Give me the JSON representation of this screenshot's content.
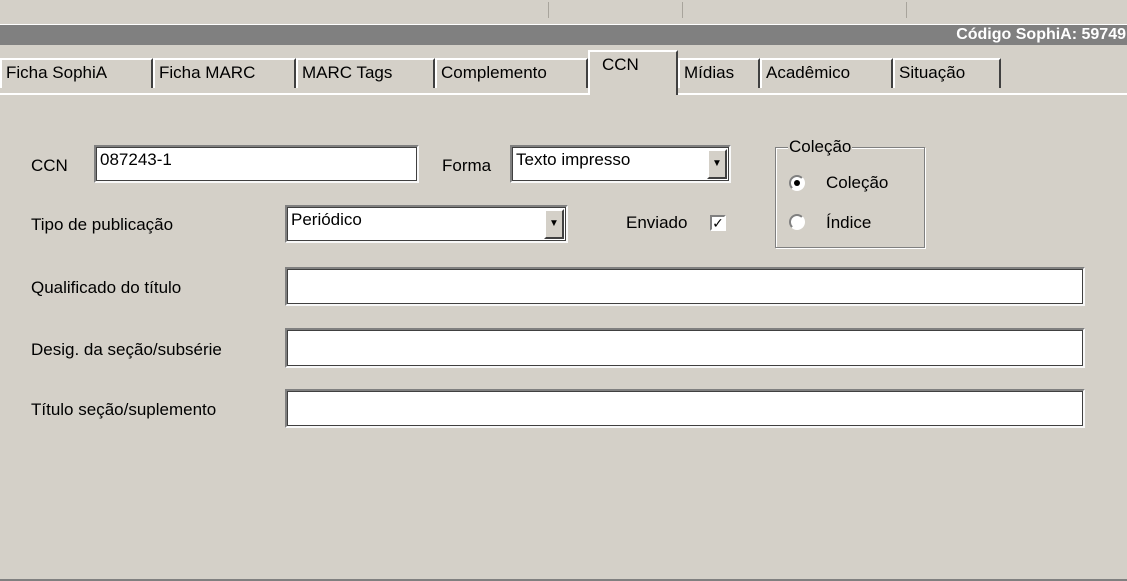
{
  "header": {
    "codigo_label": "Código SophiA: 59749"
  },
  "tabs": [
    {
      "label": "Ficha SophiA",
      "active": false
    },
    {
      "label": "Ficha MARC",
      "active": false
    },
    {
      "label": "MARC Tags",
      "active": false
    },
    {
      "label": "Complemento",
      "active": false
    },
    {
      "label": "CCN",
      "active": true
    },
    {
      "label": "Mídias",
      "active": false
    },
    {
      "label": "Acadêmico",
      "active": false
    },
    {
      "label": "Situação",
      "active": false
    }
  ],
  "form": {
    "ccn": {
      "label": "CCN",
      "value": "087243-1"
    },
    "forma": {
      "label": "Forma",
      "value": "Texto impresso"
    },
    "tipo_publicacao": {
      "label": "Tipo de publicação",
      "value": "Periódico"
    },
    "enviado": {
      "label": "Enviado",
      "checked": true,
      "mark": "✓"
    },
    "qualificado_titulo": {
      "label": "Qualificado do título",
      "value": ""
    },
    "desig_secao": {
      "label": "Desig. da seção/subsérie",
      "value": ""
    },
    "titulo_secao": {
      "label": "Título seção/suplemento",
      "value": ""
    }
  },
  "colecao_group": {
    "title": "Coleção",
    "options": [
      {
        "label": "Coleção",
        "selected": true
      },
      {
        "label": "Índice",
        "selected": false
      }
    ]
  },
  "colors": {
    "background": "#d4d0c8",
    "titlebar": "#808080",
    "titlebar_text": "#ffffff"
  }
}
